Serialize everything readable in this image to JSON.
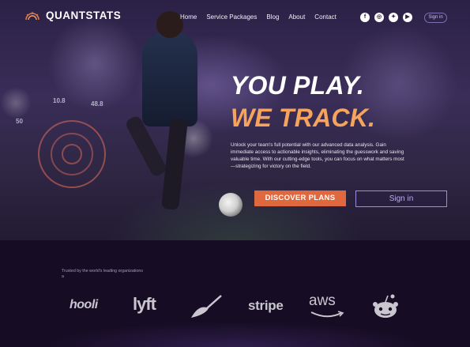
{
  "brand": {
    "name": "QUANTSTATS",
    "logo_icon": "sunrise-fan-icon",
    "accent_color": "#e0683e"
  },
  "nav": {
    "links": [
      "Home",
      "Service Packages",
      "Blog",
      "About",
      "Contact"
    ],
    "social": [
      "facebook-icon",
      "instagram-icon",
      "twitter-icon",
      "youtube-icon"
    ],
    "signin": "Sign in"
  },
  "hero": {
    "headline_1": "YOU PLAY.",
    "headline_2": "WE TRACK.",
    "description": "Unlock your team's full potential with our advanced data analysis. Gain immediate access to actionable insights, eliminating the guesswork and saving valuable time. With our cutting-edge tools, you can focus on what matters most—strategizing for victory on the field.",
    "cta_primary": "DISCOVER PLANS",
    "cta_secondary": "Sign in",
    "overlay_stats": [
      "10.8",
      "48.8",
      "50"
    ]
  },
  "trusted": {
    "label": "Trusted by the world's leading organizations",
    "marker": "a",
    "logos": [
      "hooli",
      "lyft",
      "trowel",
      "stripe",
      "aws",
      "reddit"
    ]
  }
}
